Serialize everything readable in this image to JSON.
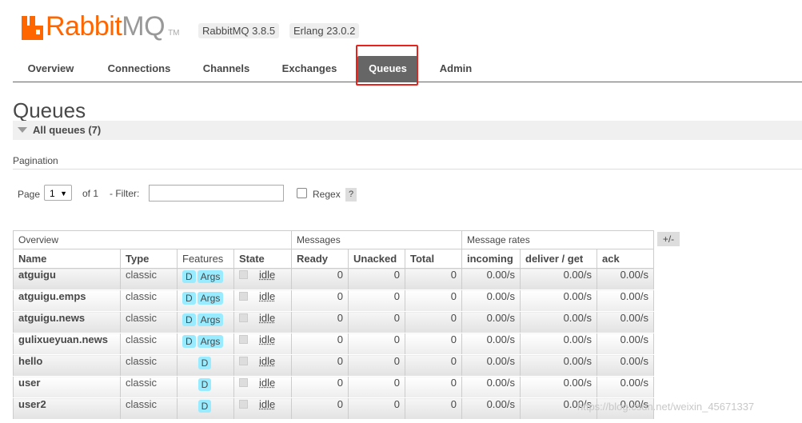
{
  "header": {
    "logo_text_main": "Rabbit",
    "logo_text_mq": "MQ",
    "logo_tm": "TM",
    "versions": [
      "RabbitMQ 3.8.5",
      "Erlang 23.0.2"
    ]
  },
  "tabs": [
    {
      "label": "Overview",
      "active": false
    },
    {
      "label": "Connections",
      "active": false
    },
    {
      "label": "Channels",
      "active": false
    },
    {
      "label": "Exchanges",
      "active": false
    },
    {
      "label": "Queues",
      "active": true
    },
    {
      "label": "Admin",
      "active": false
    }
  ],
  "page": {
    "title": "Queues",
    "section_label": "All queues (7)"
  },
  "pagination": {
    "label": "Pagination",
    "page_label": "Page",
    "page_value": "1",
    "of_label": "of 1",
    "filter_label": "- Filter:",
    "filter_value": "",
    "regex_label": "Regex",
    "help": "?"
  },
  "table": {
    "groups": [
      "Overview",
      "Messages",
      "Message rates"
    ],
    "toggle_columns": "+/-",
    "headers": [
      "Name",
      "Type",
      "Features",
      "State",
      "Ready",
      "Unacked",
      "Total",
      "incoming",
      "deliver / get",
      "ack"
    ],
    "rows": [
      {
        "name": "atguigu",
        "type": "classic",
        "features": [
          "D",
          "Args"
        ],
        "state": "idle",
        "ready": "0",
        "unacked": "0",
        "total": "0",
        "incoming": "0.00/s",
        "deliver": "0.00/s",
        "ack": "0.00/s"
      },
      {
        "name": "atguigu.emps",
        "type": "classic",
        "features": [
          "D",
          "Args"
        ],
        "state": "idle",
        "ready": "0",
        "unacked": "0",
        "total": "0",
        "incoming": "0.00/s",
        "deliver": "0.00/s",
        "ack": "0.00/s"
      },
      {
        "name": "atguigu.news",
        "type": "classic",
        "features": [
          "D",
          "Args"
        ],
        "state": "idle",
        "ready": "0",
        "unacked": "0",
        "total": "0",
        "incoming": "0.00/s",
        "deliver": "0.00/s",
        "ack": "0.00/s"
      },
      {
        "name": "gulixueyuan.news",
        "type": "classic",
        "features": [
          "D",
          "Args"
        ],
        "state": "idle",
        "ready": "0",
        "unacked": "0",
        "total": "0",
        "incoming": "0.00/s",
        "deliver": "0.00/s",
        "ack": "0.00/s"
      },
      {
        "name": "hello",
        "type": "classic",
        "features": [
          "D"
        ],
        "state": "idle",
        "ready": "0",
        "unacked": "0",
        "total": "0",
        "incoming": "0.00/s",
        "deliver": "0.00/s",
        "ack": "0.00/s"
      },
      {
        "name": "user",
        "type": "classic",
        "features": [
          "D"
        ],
        "state": "idle",
        "ready": "0",
        "unacked": "0",
        "total": "0",
        "incoming": "0.00/s",
        "deliver": "0.00/s",
        "ack": "0.00/s"
      },
      {
        "name": "user2",
        "type": "classic",
        "features": [
          "D"
        ],
        "state": "idle",
        "ready": "0",
        "unacked": "0",
        "total": "0",
        "incoming": "0.00/s",
        "deliver": "0.00/s",
        "ack": "0.00/s"
      }
    ]
  },
  "watermark": "https://blog.csdn.net/weixin_45671337",
  "colors": {
    "brand": "#ff6600",
    "tab_active_bg": "#666666",
    "highlight_box": "#e8221c",
    "feature_badge": "#99ebff"
  }
}
